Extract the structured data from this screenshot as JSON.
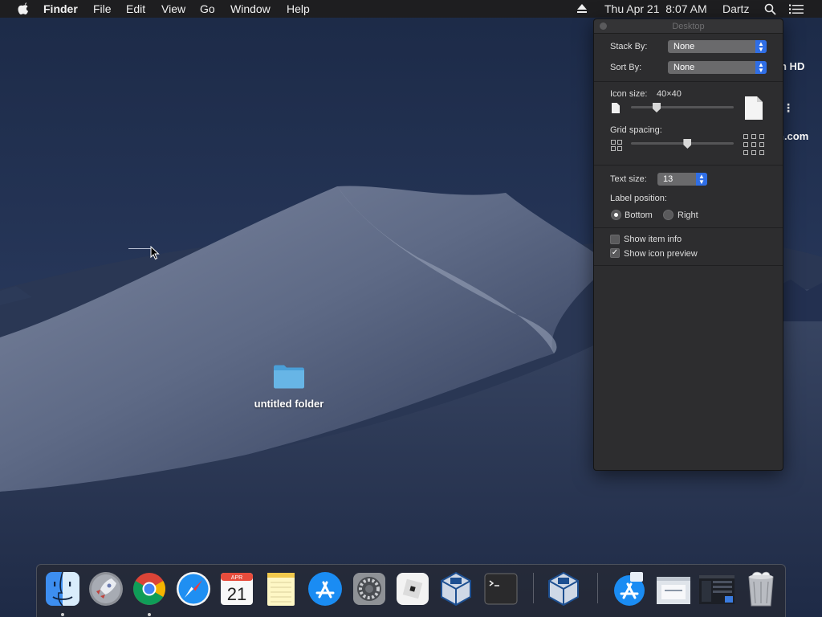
{
  "menubar": {
    "app_name": "Finder",
    "menus": [
      "File",
      "Edit",
      "View",
      "Go",
      "Window",
      "Help"
    ],
    "clock": "Thu Apr 21  8:07 AM",
    "user": "Dartz"
  },
  "desktop": {
    "edge_text_1": "n HD",
    "edge_text_2": "n.com",
    "folder_label": "untitled folder"
  },
  "panel": {
    "title": "Desktop",
    "stack_by_label": "Stack By:",
    "stack_by_value": "None",
    "sort_by_label": "Sort By:",
    "sort_by_value": "None",
    "icon_size_label": "Icon size:",
    "icon_size_value": "40×40",
    "icon_size_fraction": 0.25,
    "grid_spacing_label": "Grid spacing:",
    "grid_spacing_fraction": 0.55,
    "text_size_label": "Text size:",
    "text_size_value": "13",
    "label_position_label": "Label position:",
    "label_position_options": [
      "Bottom",
      "Right"
    ],
    "label_position_selected": "Bottom",
    "show_item_info_label": "Show item info",
    "show_item_info_checked": false,
    "show_icon_preview_label": "Show icon preview",
    "show_icon_preview_checked": true
  },
  "dock": {
    "apps": [
      "finder-icon",
      "launchpad-icon",
      "chrome-icon",
      "safari-icon",
      "calendar-icon",
      "notes-icon",
      "app-store-icon",
      "system-preferences-icon",
      "roblox-icon",
      "virtualbox-icon",
      "terminal-icon",
      "virtualbox-vm-icon",
      "app-store-download-icon",
      "document-thumbnail-icon",
      "window-thumbnail-icon",
      "trash-icon"
    ],
    "calendar_month": "APR",
    "calendar_day": "21",
    "running": [
      "finder-icon",
      "chrome-icon"
    ]
  }
}
